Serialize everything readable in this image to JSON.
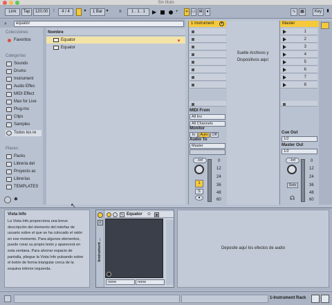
{
  "window": {
    "title": "Sin título"
  },
  "toolbar": {
    "link": "Link",
    "tap": "Tap",
    "tempo": "120.00",
    "time_sig": "4 / 4",
    "metronome": "●●",
    "quantize": "1 Bar",
    "position": "1 .  1 .  1",
    "key": "Key"
  },
  "browser": {
    "search_value": "equator",
    "sections": {
      "collections": "Colecciones",
      "categories": "Categorías",
      "places": "Places"
    },
    "collections": [
      {
        "label": "Favoritos",
        "color": "#e24b3b"
      }
    ],
    "categories": [
      "Sounds",
      "Drums",
      "Instrument",
      "Audio Effec",
      "MIDI Effect",
      "Max for Live",
      "Plug-Ins",
      "Clips",
      "Samples",
      "Todos los re"
    ],
    "places": [
      "Packs",
      "Librería del",
      "Proyecto ac",
      "Librerías",
      "TEMPLATES"
    ],
    "column_header": "Nombre",
    "results": [
      {
        "label": "Equator",
        "selected": true
      },
      {
        "label": "Equator",
        "selected": false
      }
    ]
  },
  "track": {
    "name": "1 Instrument",
    "io": {
      "midi_from_label": "MIDI From",
      "midi_from": "All Ins",
      "channel": "All Channels",
      "monitor_label": "Monitor",
      "monitor_in": "In",
      "monitor_auto": "Auto",
      "monitor_off": "Off",
      "audio_to_label": "Audio To",
      "audio_to": "Master"
    },
    "volume": "-Inf",
    "track_number": "1",
    "solo": "S",
    "meter_scale": [
      "0",
      "12",
      "24",
      "36",
      "48",
      "60"
    ]
  },
  "drop_area": {
    "line1": "Suelte Archivos y",
    "line2": "Dispositivos aquí"
  },
  "master": {
    "name": "Master",
    "scenes": [
      "1",
      "2",
      "3",
      "4",
      "5",
      "6",
      "7",
      "8"
    ],
    "cue_out_label": "Cue Out",
    "cue_out": "1/2",
    "master_out_label": "Master Out",
    "master_out": "1/2",
    "volume": "-Inf",
    "solo_label": "Solo",
    "meter_scale": [
      "0",
      "12",
      "24",
      "36",
      "48",
      "60"
    ]
  },
  "info": {
    "title": "Vista Info",
    "body": "La Vista Info proporciona una breve descripción del elemento del interfaz de usuario sobre el que se ha colocado el ratón en ese momento. Para algunos elementos, puede crear su propio texto y aparecerá en esta ventana. Para ahorrar espacio de pantalla, pliegue la Vista Info pulsando sobre el botón de forma triangular cerca de la esquina inferior izquierda."
  },
  "device": {
    "rack_label": "Instrument ...",
    "name": "Equator",
    "field_left": "none",
    "field_right": "none"
  },
  "fx_drop": "Deposite aquí los efectos de audio",
  "status": {
    "track_label": "1-Instrument Rack"
  },
  "colors": {
    "accent": "#f5c93a",
    "panel": "#b9c2d1",
    "selection": "#f3e3a6"
  }
}
